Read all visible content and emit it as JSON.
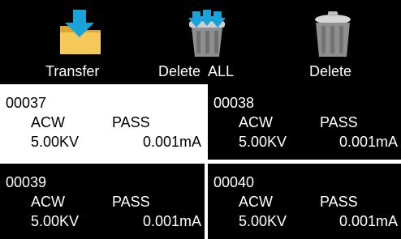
{
  "toolbar": {
    "transfer": {
      "label": "Transfer",
      "icon": "folder-download-icon"
    },
    "delete_all": {
      "label": "Delete  ALL",
      "icon": "trash-all-icon"
    },
    "delete": {
      "label": "Delete",
      "icon": "trash-icon"
    }
  },
  "records": [
    {
      "id": "00037",
      "mode": "ACW",
      "result": "PASS",
      "voltage": "5.00KV",
      "current": "0.001mA",
      "selected": true
    },
    {
      "id": "00038",
      "mode": "ACW",
      "result": "PASS",
      "voltage": "5.00KV",
      "current": "0.001mA",
      "selected": false
    },
    {
      "id": "00039",
      "mode": "ACW",
      "result": "PASS",
      "voltage": "5.00KV",
      "current": "0.001mA",
      "selected": false
    },
    {
      "id": "00040",
      "mode": "ACW",
      "result": "PASS",
      "voltage": "5.00KV",
      "current": "0.001mA",
      "selected": false
    }
  ],
  "colors": {
    "background": "#000000",
    "selected_card": "#ffffff",
    "folder": "#f0c24a",
    "arrow": "#1aa3d9",
    "trash": "#9a9a9a"
  }
}
